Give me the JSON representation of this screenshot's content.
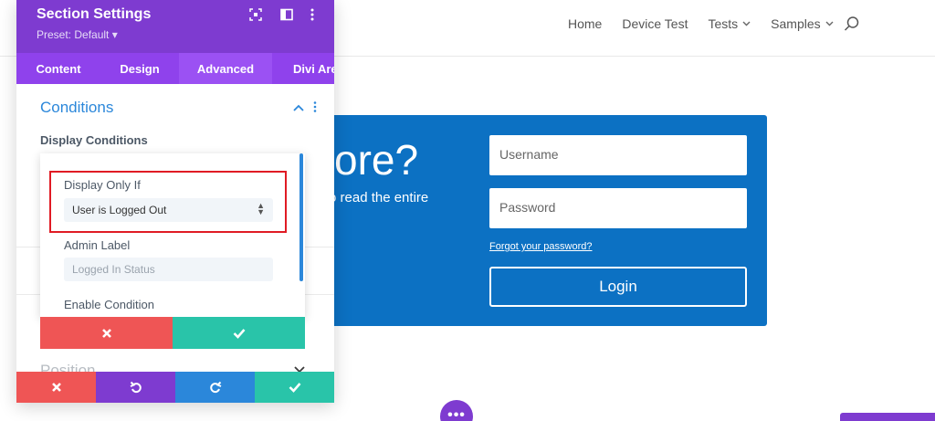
{
  "site_nav": {
    "items": [
      {
        "label": "Home",
        "has_dropdown": false
      },
      {
        "label": "Device Test",
        "has_dropdown": false
      },
      {
        "label": "Tests",
        "has_dropdown": true
      },
      {
        "label": "Samples",
        "has_dropdown": true
      }
    ],
    "search_icon": "search-icon"
  },
  "login": {
    "heading_partial": "ore?",
    "description_partial": "o read the entire",
    "username_placeholder": "Username",
    "password_placeholder": "Password",
    "forgot_link": "Forgot your password?",
    "login_button": "Login"
  },
  "dots_button": "•••",
  "panel": {
    "title": "Section Settings",
    "preset": "Preset: Default ▾",
    "header_icons": [
      "focus-icon",
      "split-view-icon",
      "more-vertical-icon"
    ],
    "tabs": [
      {
        "label": "Content",
        "active": false
      },
      {
        "label": "Design",
        "active": false
      },
      {
        "label": "Advanced",
        "active": true
      },
      {
        "label": "Divi Are",
        "active": false
      }
    ],
    "section_title": "Conditions",
    "display_conditions_label": "Display Conditions",
    "condition": {
      "display_only_if_label": "Display Only If",
      "display_only_if_value": "User is Logged Out",
      "admin_label_label": "Admin Label",
      "admin_label_placeholder": "Logged In Status",
      "enable_condition_label": "Enable Condition"
    },
    "position_label": "Position",
    "footer_buttons": [
      "close-icon",
      "undo-icon",
      "redo-icon",
      "check-icon"
    ]
  },
  "colors": {
    "panel_purple": "#7e3bd0",
    "tab_purple": "#8f42ec",
    "accent_blue": "#2b87da",
    "login_blue": "#0c71c3",
    "cancel_red": "#ef5555",
    "confirm_green": "#29c4a9",
    "highlight_red": "#e01b24"
  }
}
